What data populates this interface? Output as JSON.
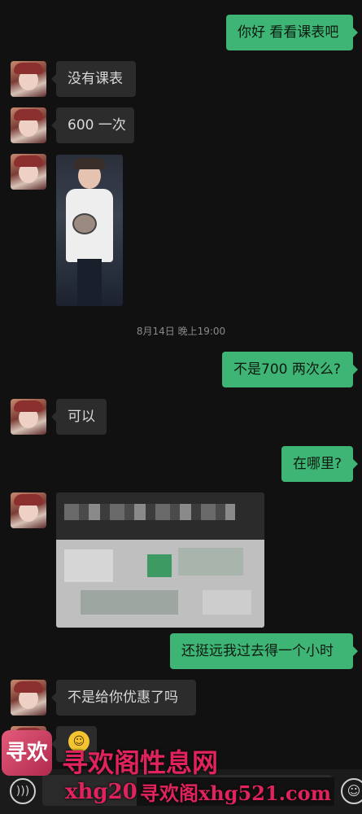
{
  "messages": [
    {
      "side": "out",
      "text": "你好 看看课表吧"
    },
    {
      "side": "in",
      "text": "没有课表"
    },
    {
      "side": "in",
      "text": "600 一次"
    },
    {
      "side": "in",
      "type": "image"
    },
    {
      "side": "out",
      "text": "不是700 两次么?"
    },
    {
      "side": "in",
      "text": "可以"
    },
    {
      "side": "out",
      "text": "在哪里?"
    },
    {
      "side": "in",
      "type": "location"
    },
    {
      "side": "out",
      "text": "还挺远我过去得一个小时"
    },
    {
      "side": "in",
      "text": "不是给你优惠了吗"
    }
  ],
  "timestamp": "8月14日 晚上19:00",
  "watermark": {
    "logo_text": "寻欢",
    "title": "寻欢阁性息网",
    "site1": "xhg20",
    "site2": "寻欢阁xhg521.com"
  },
  "colors": {
    "background": "#111111",
    "incoming_bubble": "#2c2c2c",
    "outgoing_bubble": "#3eb575",
    "watermark": "#e0235c"
  },
  "icons": {
    "voice": "voice-icon",
    "emoji": "emoji-icon"
  }
}
